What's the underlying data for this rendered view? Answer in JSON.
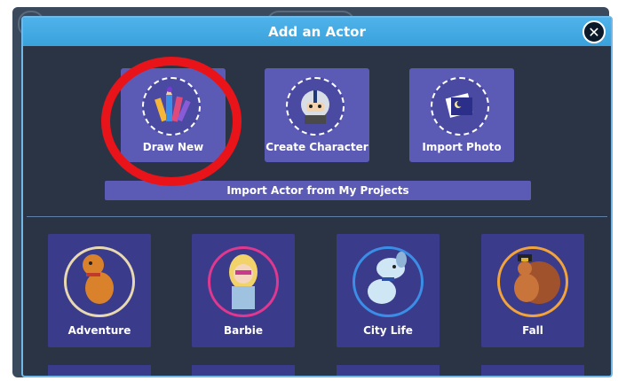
{
  "dialog": {
    "title": "Add an Actor",
    "close_icon": "close-icon"
  },
  "options": [
    {
      "label": "Draw New",
      "icon": "pencils-icon"
    },
    {
      "label": "Create Character",
      "icon": "character-icon"
    },
    {
      "label": "Import Photo",
      "icon": "photo-icon"
    }
  ],
  "import_button": {
    "label": "Import Actor from My Projects"
  },
  "categories": [
    {
      "label": "Adventure",
      "icon": "dinosaur-icon",
      "ring_color": "#e8d9b0"
    },
    {
      "label": "Barbie",
      "icon": "barbie-icon",
      "ring_color": "#e0388f"
    },
    {
      "label": "City Life",
      "icon": "dog-icon",
      "ring_color": "#3a8ee6"
    },
    {
      "label": "Fall",
      "icon": "turkey-icon",
      "ring_color": "#f2a43a"
    }
  ],
  "colors": {
    "header": "#4fb3ea",
    "tile": "#5b5bb5",
    "category_tile": "#3b3b8c",
    "highlight": "#e8141a"
  }
}
